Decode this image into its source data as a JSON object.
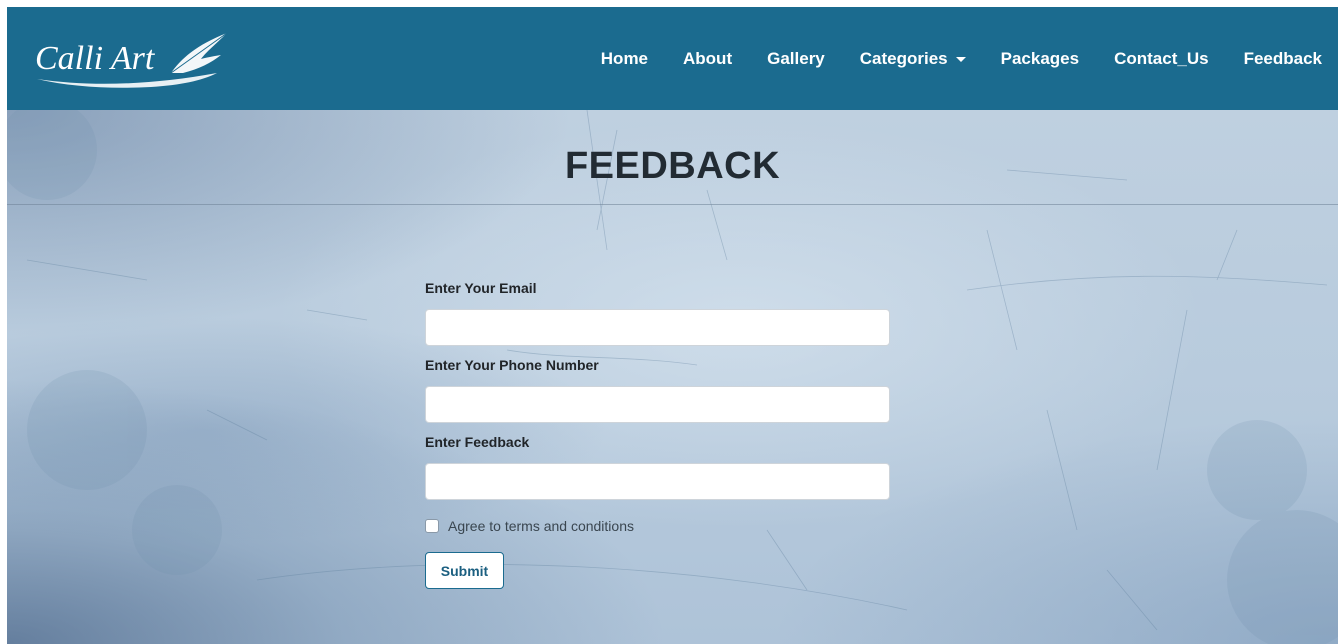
{
  "brand": {
    "logo_text": "Calli Art",
    "logo_icon": "quill-feather-icon"
  },
  "nav": {
    "items": [
      {
        "label": "Home"
      },
      {
        "label": "About"
      },
      {
        "label": "Gallery"
      },
      {
        "label": "Categories"
      },
      {
        "label": "Packages"
      },
      {
        "label": "Contact_Us"
      },
      {
        "label": "Feedback"
      }
    ],
    "dropdown_icon": "caret-down-icon"
  },
  "page": {
    "title": "FEEDBACK"
  },
  "form": {
    "email_label": "Enter Your Email",
    "email_value": "",
    "phone_label": "Enter Your Phone Number",
    "phone_value": "",
    "feedback_label": "Enter Feedback",
    "feedback_value": "",
    "terms_label": "Agree to terms and conditions",
    "terms_checked": false,
    "submit_label": "Submit"
  },
  "colors": {
    "navbar": "#1b6b8f",
    "nav_text": "#ffffff",
    "title_text": "#222b33",
    "submit_border": "#1b6b8f"
  }
}
